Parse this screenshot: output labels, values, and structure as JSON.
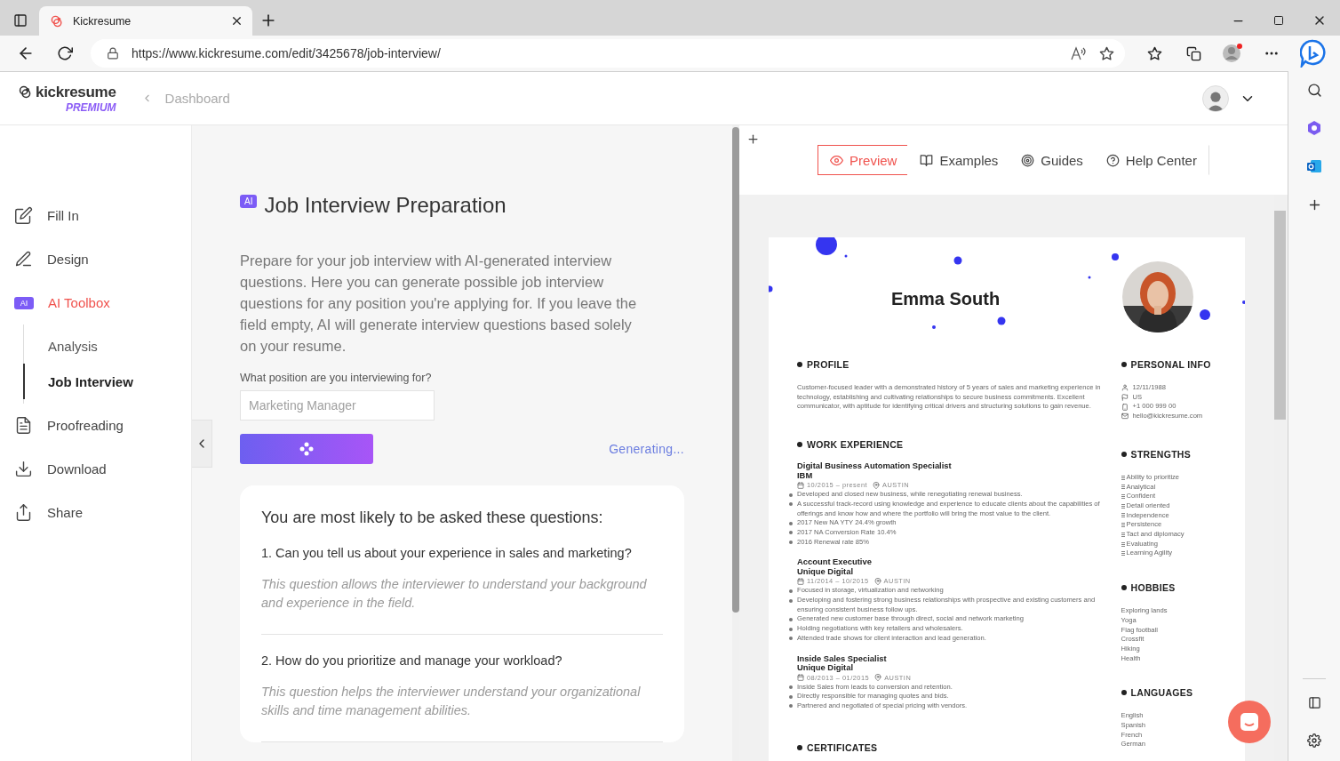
{
  "browser": {
    "tab_title": "Kickresume",
    "url": "https://www.kickresume.com/edit/3425678/job-interview/"
  },
  "header": {
    "logo": "kickresume",
    "logo_badge": "PREMIUM",
    "breadcrumb": "Dashboard"
  },
  "nav": {
    "items": [
      {
        "label": "Fill In",
        "selected": false
      },
      {
        "label": "Design",
        "selected": false
      },
      {
        "label": "AI Toolbox",
        "badge": "AI",
        "selected": true,
        "children": [
          {
            "label": "Analysis",
            "selected": false
          },
          {
            "label": "Job Interview",
            "selected": true
          }
        ]
      },
      {
        "label": "Proofreading",
        "selected": false
      },
      {
        "label": "Download",
        "selected": false
      },
      {
        "label": "Share",
        "selected": false
      }
    ]
  },
  "panel": {
    "badge": "AI",
    "title": "Job Interview Preparation",
    "description": "Prepare for your job interview with AI-generated interview questions. Here you can generate possible job interview questions for any position you're applying for. If you leave the field empty, AI will generate interview questions based solely on your resume.",
    "field_label": "What position are you interviewing for?",
    "placeholder": "Marketing Manager",
    "status": "Generating...",
    "questions_title": "You are most likely to be asked these questions:",
    "questions": [
      {
        "question": "1. Can you tell us about your experience in sales and marketing?",
        "hint": "This question allows the interviewer to understand your background and experience in the field."
      },
      {
        "question": "2. How do you prioritize and manage your workload?",
        "hint": "This question helps the interviewer understand your organizational skills and time management abilities."
      }
    ]
  },
  "preview_toolbar": {
    "buttons": [
      {
        "label": "Preview",
        "selected": true
      },
      {
        "label": "Examples",
        "selected": false
      },
      {
        "label": "Guides",
        "selected": false
      },
      {
        "label": "Help Center",
        "selected": false
      }
    ]
  },
  "resume": {
    "name": "Emma South",
    "left_sections": [
      {
        "kind": "text",
        "heading": "PROFILE",
        "text": "Customer-focused leader with a demonstrated history of 5 years of sales and marketing experience in technology, establishing and cultivating relationships to secure business commitments. Excellent communicator, with aptitude for identifying critical drivers and structuring solutions to gain revenue."
      },
      {
        "kind": "jobs",
        "heading": "WORK EXPERIENCE",
        "jobs": [
          {
            "title": "Digital Business Automation Specialist",
            "company": "IBM",
            "dates": "10/2015 – present",
            "location": "AUSTIN",
            "bullets": [
              "Developed and closed new business, while renegotiating renewal business.",
              "A successful track-record using knowledge and experience  to educate clients about the capabilities of offerings and know how and where the portfolio will bring the most value to the client.",
              "2017 New NA YTY 24.4% growth",
              "2017 NA Conversion Rate 10.4%",
              "2016 Renewal rate 85%"
            ]
          },
          {
            "title": "Account Executive",
            "company": "Unique Digital",
            "dates": "11/2014 – 10/2015",
            "location": "AUSTIN",
            "bullets": [
              "Focused in storage, virtualization and networking",
              "Developing and fostering strong business relationships with prospective and existing customers and ensuring consistent business follow ups.",
              "Generated new customer base through direct, social and network marketing",
              "Holding negotiations with key retailers and wholesalers.",
              "Attended trade shows for client interaction and lead generation."
            ]
          },
          {
            "title": "Inside Sales Specialist",
            "company": "Unique Digital",
            "dates": "08/2013 – 01/2015",
            "location": "AUSTIN",
            "bullets": [
              "Inside Sales from leads to conversion and retention.",
              "Directly responsible for managing quotes and bids.",
              "Partnered and negotiated of special pricing with vendors."
            ]
          }
        ]
      },
      {
        "kind": "heading",
        "heading": "CERTIFICATES"
      }
    ],
    "right_sections": [
      {
        "kind": "contacts",
        "heading": "PERSONAL INFO",
        "items": [
          "12/11/1988",
          "US",
          "+1 000 999 00",
          "hello@kickresume.com"
        ]
      },
      {
        "kind": "bars",
        "heading": "STRENGTHS",
        "items": [
          "Ability to prioritize",
          "Analytical",
          "Confident",
          "Detail oriented",
          "Independence",
          "Persistence",
          "Tact and diplomacy",
          "Evaluating",
          "Learning Agility"
        ]
      },
      {
        "kind": "plain",
        "heading": "HOBBIES",
        "items": [
          "Exploring lands",
          "Yoga",
          "Flag football",
          "Crossfit",
          "Hiking",
          "Health"
        ]
      },
      {
        "kind": "plain",
        "heading": "LANGUAGES",
        "items": [
          "English",
          "Spanish",
          "French",
          "German"
        ]
      }
    ]
  }
}
